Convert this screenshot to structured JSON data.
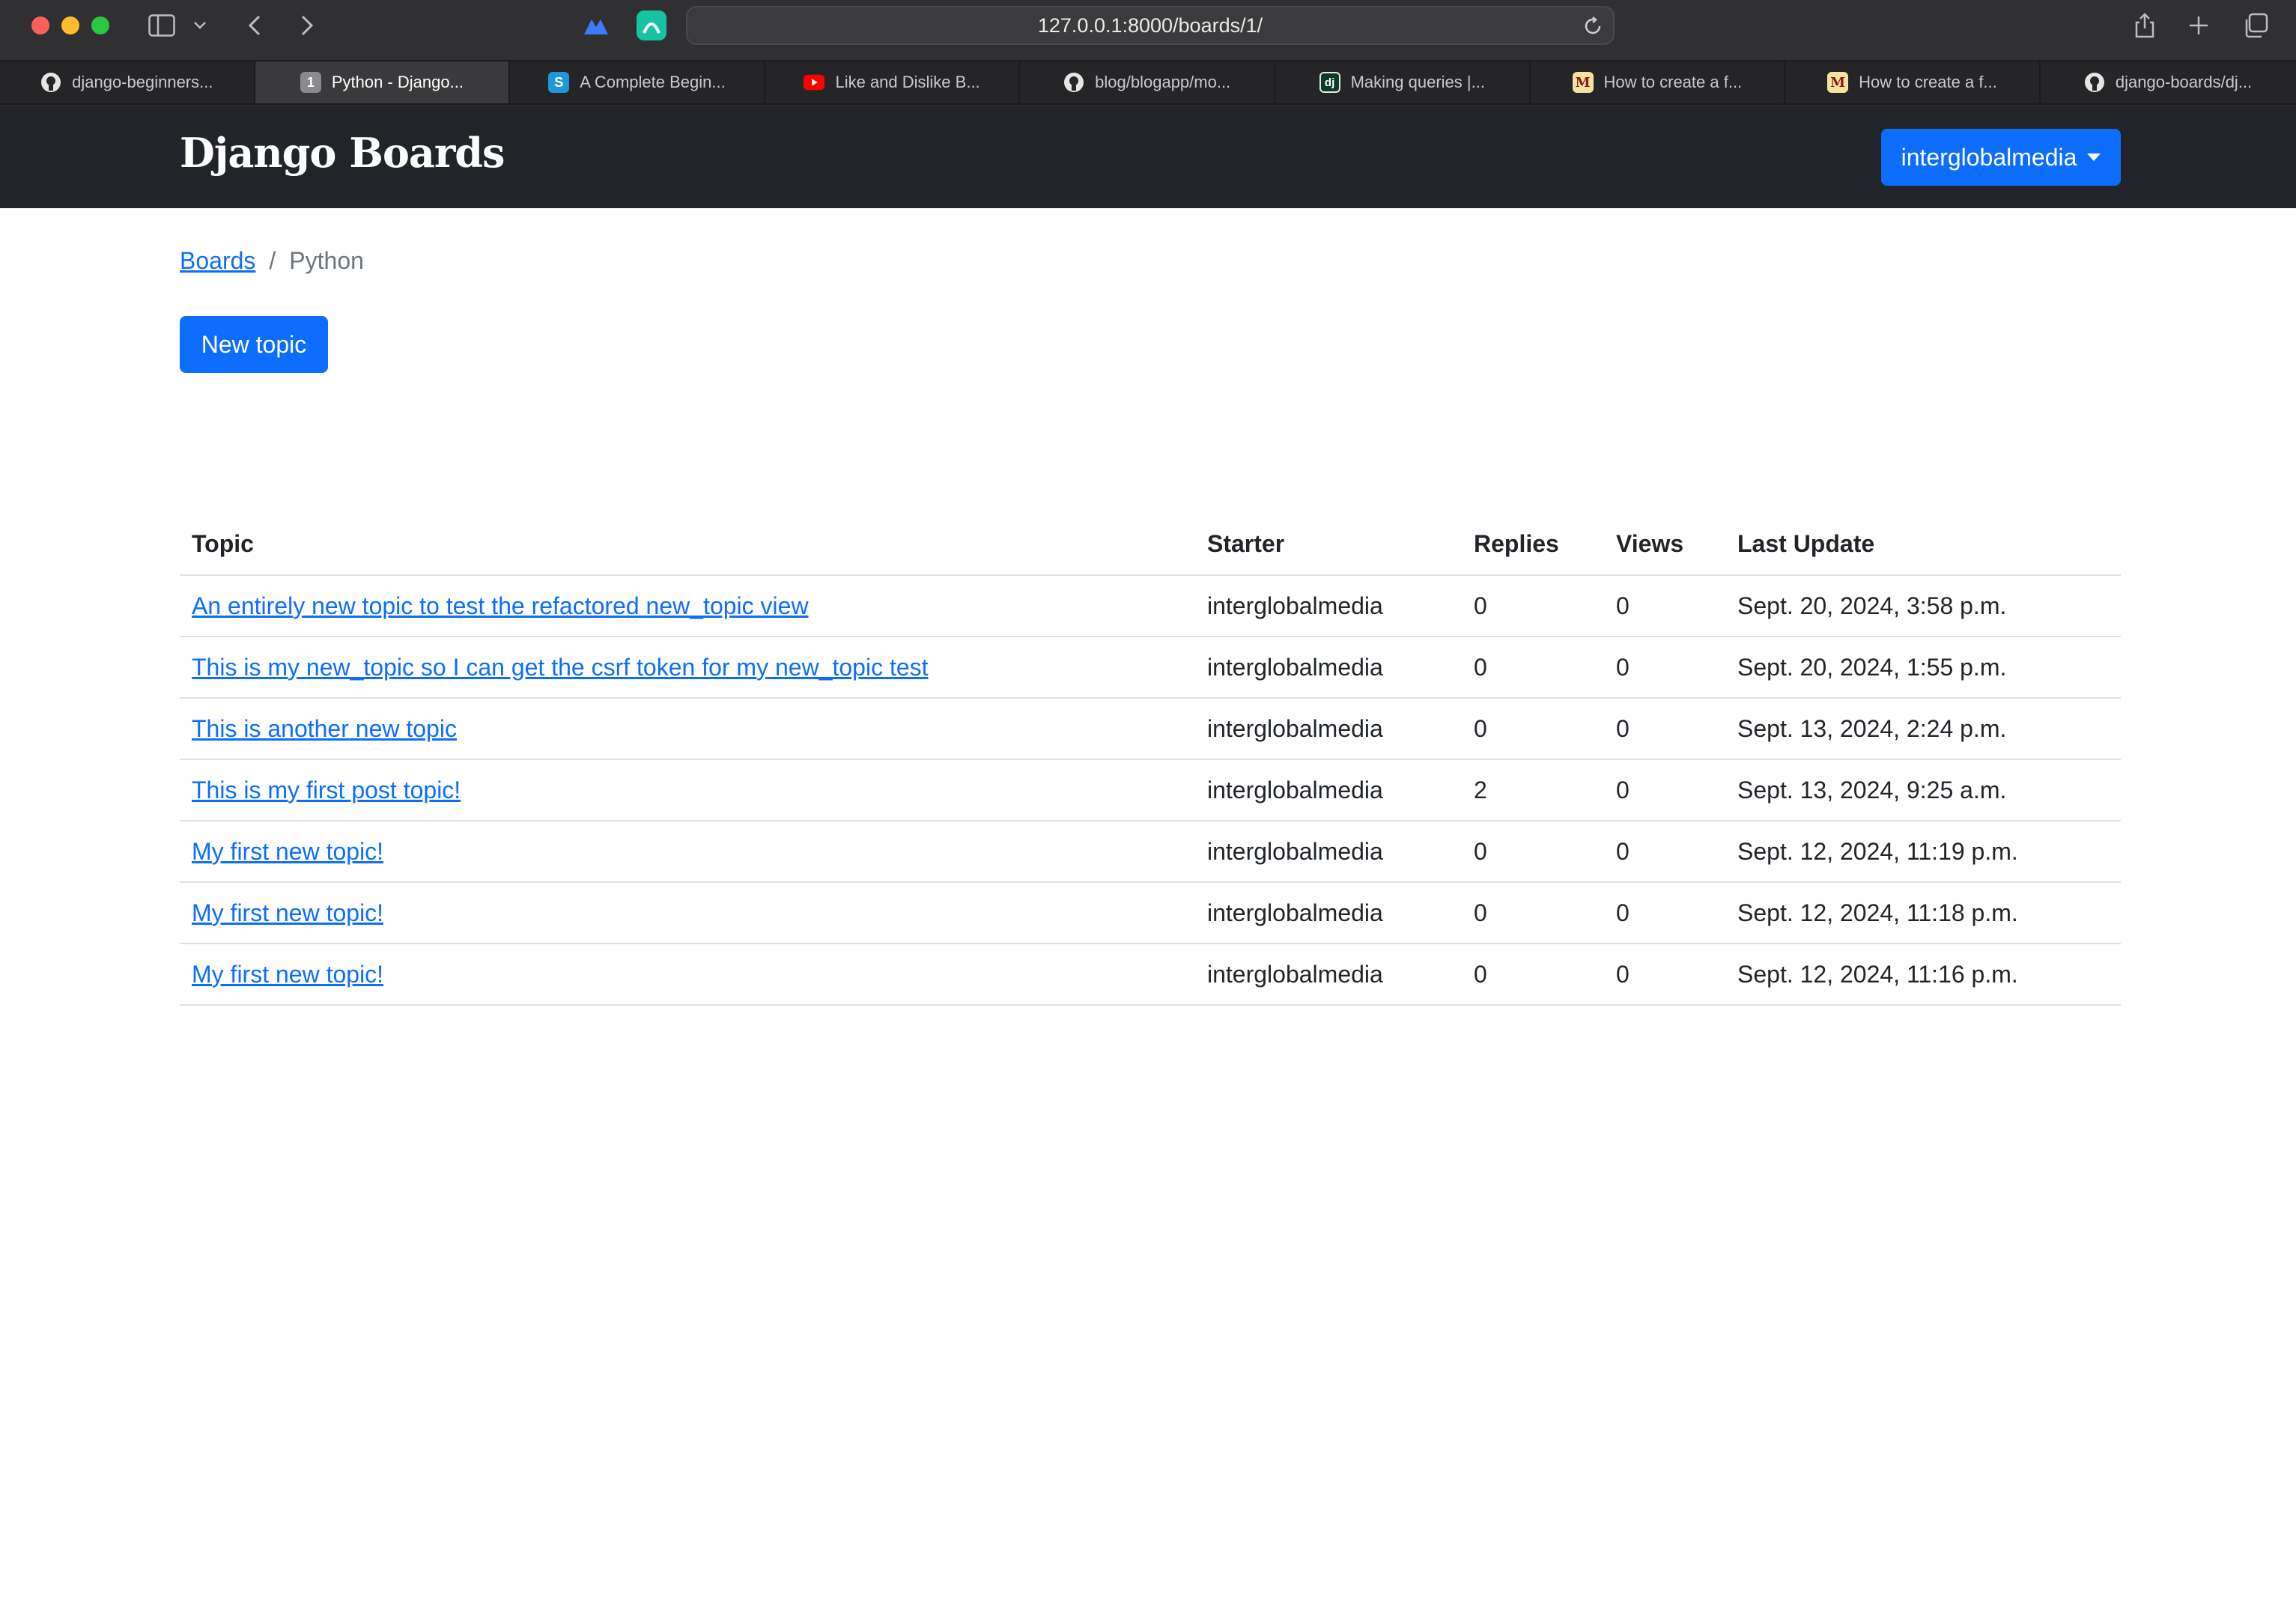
{
  "browser": {
    "url": "127.0.0.1:8000/boards/1/",
    "tabs": [
      {
        "label": "django-beginners...",
        "icon": "github-icon",
        "active": false
      },
      {
        "label": "Python - Django...",
        "icon": "tab-number-icon",
        "badge": "1",
        "active": true
      },
      {
        "label": "A Complete Begin...",
        "icon": "s-site-icon",
        "badge": "S",
        "active": false
      },
      {
        "label": "Like and Dislike B...",
        "icon": "youtube-icon",
        "active": false
      },
      {
        "label": "blog/blogapp/mo...",
        "icon": "github-icon",
        "active": false
      },
      {
        "label": "Making queries |...",
        "icon": "django-icon",
        "badge": "dj",
        "active": false
      },
      {
        "label": "How to create a f...",
        "icon": "medium-icon",
        "badge": "M",
        "active": false
      },
      {
        "label": "How to create a f...",
        "icon": "medium-icon",
        "badge": "M",
        "active": false
      },
      {
        "label": "django-boards/dj...",
        "icon": "github-icon",
        "active": false
      }
    ]
  },
  "navbar": {
    "brand": "Django Boards",
    "user": "interglobalmedia"
  },
  "breadcrumb": {
    "root": "Boards",
    "separator": "/",
    "current": "Python"
  },
  "actions": {
    "new_topic": "New topic"
  },
  "table": {
    "headers": {
      "topic": "Topic",
      "starter": "Starter",
      "replies": "Replies",
      "views": "Views",
      "last_update": "Last Update"
    },
    "rows": [
      {
        "topic": "An entirely new topic to test the refactored new_topic view",
        "starter": "interglobalmedia",
        "replies": "0",
        "views": "0",
        "last_update": "Sept. 20, 2024, 3:58 p.m."
      },
      {
        "topic": "This is my new_topic so I can get the csrf token for my new_topic test",
        "starter": "interglobalmedia",
        "replies": "0",
        "views": "0",
        "last_update": "Sept. 20, 2024, 1:55 p.m."
      },
      {
        "topic": "This is another new topic",
        "starter": "interglobalmedia",
        "replies": "0",
        "views": "0",
        "last_update": "Sept. 13, 2024, 2:24 p.m."
      },
      {
        "topic": "This is my first post topic!",
        "starter": "interglobalmedia",
        "replies": "2",
        "views": "0",
        "last_update": "Sept. 13, 2024, 9:25 a.m."
      },
      {
        "topic": "My first new topic!",
        "starter": "interglobalmedia",
        "replies": "0",
        "views": "0",
        "last_update": "Sept. 12, 2024, 11:19 p.m."
      },
      {
        "topic": "My first new topic!",
        "starter": "interglobalmedia",
        "replies": "0",
        "views": "0",
        "last_update": "Sept. 12, 2024, 11:18 p.m."
      },
      {
        "topic": "My first new topic!",
        "starter": "interglobalmedia",
        "replies": "0",
        "views": "0",
        "last_update": "Sept. 12, 2024, 11:16 p.m."
      }
    ]
  },
  "colors": {
    "navbar_bg": "#212529",
    "primary": "#0d6efd",
    "link": "#0d6efd"
  }
}
